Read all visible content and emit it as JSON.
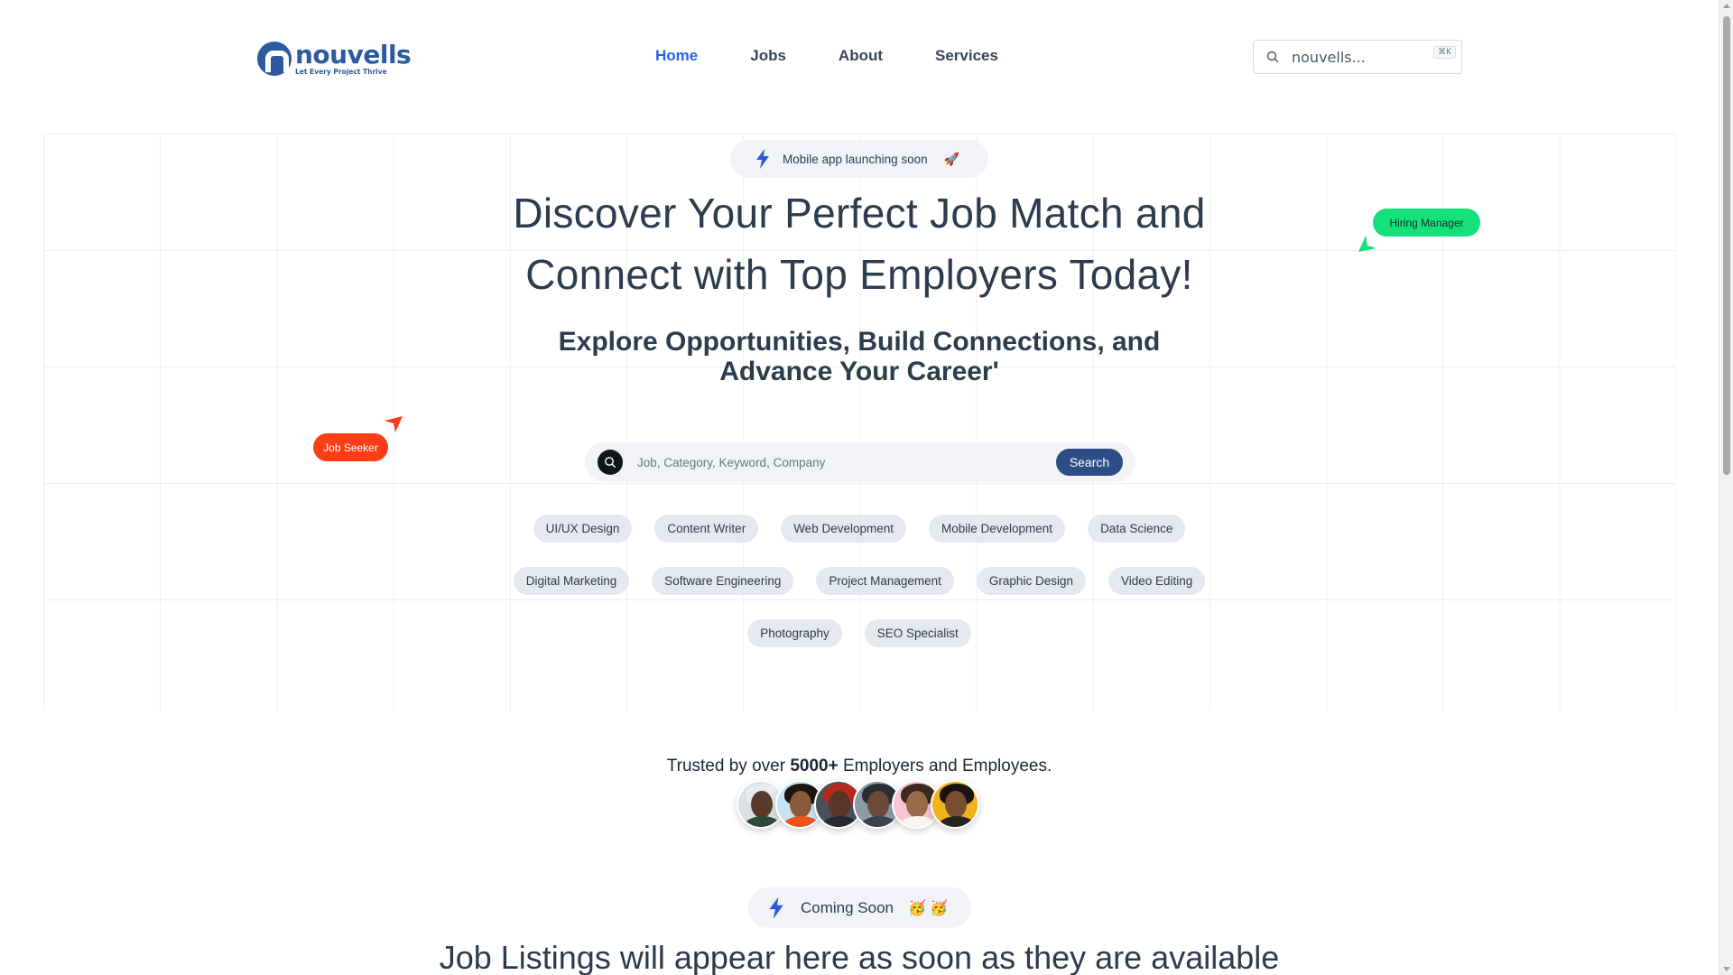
{
  "brand": {
    "name": "nouvells",
    "tagline": "Let Every Project Thrive",
    "color": "#2c5aa0"
  },
  "nav": {
    "items": [
      {
        "label": "Home",
        "active": true
      },
      {
        "label": "Jobs"
      },
      {
        "label": "About"
      },
      {
        "label": "Services"
      }
    ],
    "search": {
      "placeholder": "nouvells...",
      "shortcut": "⌘K"
    }
  },
  "hero": {
    "announcement": "Mobile app launching soon",
    "announcement_emoji": "🚀",
    "title_line1": "Discover Your Perfect Job Match and",
    "title_line2": "Connect with Top Employers Today!",
    "subtitle": "Explore Opportunities, Build Connections, and Advance Your Career'",
    "tag_hiring": "Hiring Manager",
    "tag_seeker": "Job Seeker",
    "search": {
      "placeholder": "Job, Category, Keyword, Company",
      "button": "Search"
    },
    "categories": [
      [
        "UI/UX Design",
        "Content Writer",
        "Web Development",
        "Mobile Development",
        "Data Science"
      ],
      [
        "Digital Marketing",
        "Software Engineering",
        "Project Management",
        "Graphic Design",
        "Video Editing"
      ],
      [
        "Photography",
        "SEO Specialist"
      ]
    ]
  },
  "trust": {
    "prefix": "Trusted by over ",
    "count": "5000+",
    "suffix": " Employers and Employees."
  },
  "coming_soon": {
    "label": "Coming Soon",
    "emoji": "🥳🥳"
  },
  "listings_message": "Job Listings will appear here as soon as they are available",
  "colors": {
    "accent": "#2563eb",
    "hiring": "#14e07c",
    "seeker": "#fc3d16",
    "search_button": "#2c4d86"
  }
}
